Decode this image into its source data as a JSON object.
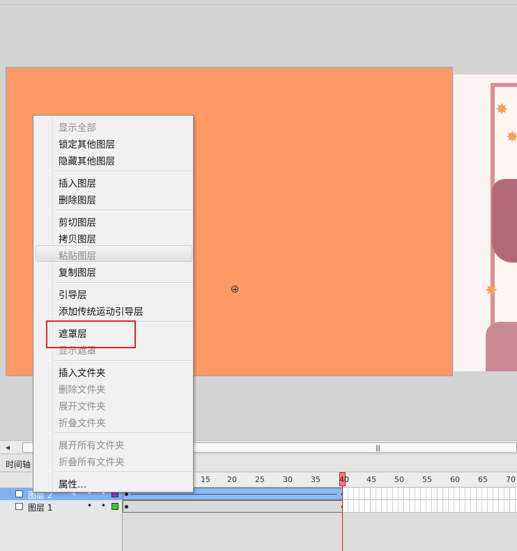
{
  "menu": {
    "items": [
      {
        "label": "显示全部",
        "enabled": false
      },
      {
        "label": "锁定其他图层",
        "enabled": true
      },
      {
        "label": "隐藏其他图层",
        "enabled": true
      },
      {
        "label": "插入图层",
        "enabled": true
      },
      {
        "label": "删除图层",
        "enabled": true
      },
      {
        "label": "剪切图层",
        "enabled": true
      },
      {
        "label": "拷贝图层",
        "enabled": true
      },
      {
        "label": "粘贴图层",
        "enabled": false
      },
      {
        "label": "复制图层",
        "enabled": true
      },
      {
        "label": "引导层",
        "enabled": true
      },
      {
        "label": "添加传统运动引导层",
        "enabled": true
      },
      {
        "label": "遮罩层",
        "enabled": true
      },
      {
        "label": "显示遮罩",
        "enabled": false
      },
      {
        "label": "插入文件夹",
        "enabled": true
      },
      {
        "label": "删除文件夹",
        "enabled": false
      },
      {
        "label": "展开文件夹",
        "enabled": false
      },
      {
        "label": "折叠文件夹",
        "enabled": false
      },
      {
        "label": "展开所有文件夹",
        "enabled": false
      },
      {
        "label": "折叠所有文件夹",
        "enabled": false
      },
      {
        "label": "属性...",
        "enabled": true
      }
    ]
  },
  "timeline": {
    "panel_title": "时间轴",
    "ruler_numbers": [
      "15",
      "20",
      "25",
      "30",
      "35",
      "40",
      "45",
      "50",
      "55",
      "60",
      "65",
      "70"
    ],
    "current_frame": "40",
    "layers": [
      {
        "name": "图层 2",
        "selected": true,
        "color": "#9933cc"
      },
      {
        "name": "图层 1",
        "selected": false,
        "color": "#33cc33"
      }
    ]
  },
  "scrollbar": {
    "left_arrow": "◂",
    "grip": "|||"
  },
  "colors": {
    "stage": "#ff9966",
    "highlight_box": "#d9232a",
    "selection": "#7fb0f0",
    "playhead": "#d61c1c"
  },
  "icons": {
    "pencil": "✎",
    "visibility_dot": "•",
    "stage_center": "crosshair-icon"
  }
}
